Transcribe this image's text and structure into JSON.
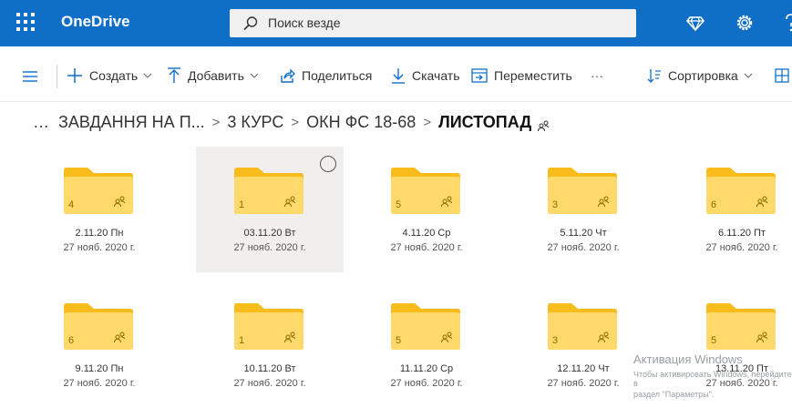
{
  "app": {
    "title": "OneDrive"
  },
  "search": {
    "placeholder": "Поиск везде"
  },
  "commands": {
    "create": "Создать",
    "upload": "Добавить",
    "share": "Поделиться",
    "download": "Скачать",
    "move": "Переместить",
    "more": "···",
    "sort": "Сортировка"
  },
  "breadcrumb": {
    "ellipsis": "…",
    "items": [
      "ЗАВДАННЯ НА П...",
      "3 КУРС",
      "ОКН ФС 18-68"
    ],
    "current": "ЛИСТОПАД"
  },
  "folders": [
    {
      "name": "2.11.20 Пн",
      "date": "27 нояб. 2020 г.",
      "count": "4"
    },
    {
      "name": "03.11.20 Вт",
      "date": "27 нояб. 2020 г.",
      "count": "1"
    },
    {
      "name": "4.11.20 Ср",
      "date": "27 нояб. 2020 г.",
      "count": "5"
    },
    {
      "name": "5.11.20 Чт",
      "date": "27 нояб. 2020 г.",
      "count": "3"
    },
    {
      "name": "6.11.20 Пт",
      "date": "27 нояб. 2020 г.",
      "count": "6"
    },
    {
      "name": "9.11.20 Пн",
      "date": "27 нояб. 2020 г.",
      "count": "6"
    },
    {
      "name": "10.11.20 Вт",
      "date": "27 нояб. 2020 г.",
      "count": "1"
    },
    {
      "name": "11.11.20 Ср",
      "date": "27 нояб. 2020 г.",
      "count": "5"
    },
    {
      "name": "12.11.20 Чт",
      "date": "27 нояб. 2020 г.",
      "count": "3"
    },
    {
      "name": "13.11.20 Пт",
      "date": "27 нояб. 2020 г.",
      "count": "5"
    }
  ],
  "watermark": {
    "line1": "Активация Windows",
    "line2": "Чтобы активировать Windows, перейдите в",
    "line3": "раздел \"Параметры\"."
  },
  "colors": {
    "header": "#0f6fc6",
    "folder": "#ffd96a",
    "folder_tab": "#f8bd1c",
    "selected_tile": "#f0efee"
  },
  "icons": [
    "app-launcher-icon",
    "search-icon",
    "premium-diamond-icon",
    "settings-gear-icon",
    "help-icon",
    "hamburger-menu-icon",
    "plus-icon",
    "upload-icon",
    "share-icon",
    "download-icon",
    "move-icon",
    "sort-icon",
    "view-tiles-icon",
    "shared-people-icon",
    "folder-icon"
  ]
}
